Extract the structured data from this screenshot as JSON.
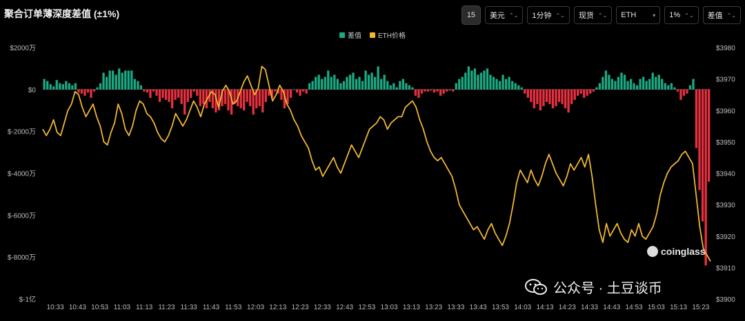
{
  "title": "聚合订单薄深度差值 (±1%)",
  "toolbar": {
    "icon": "15",
    "selects": [
      {
        "label": "美元",
        "chev": "⌃⌄"
      },
      {
        "label": "1分钟",
        "chev": "⌃⌄"
      },
      {
        "label": "现货",
        "chev": "⌃⌄"
      },
      {
        "label": "ETH",
        "chev": "▾"
      },
      {
        "label": "1%",
        "chev": "⌃⌄"
      },
      {
        "label": "差值",
        "chev": "⌃⌄"
      }
    ]
  },
  "legend": {
    "diff": {
      "label": "差值",
      "color": "#1aa983"
    },
    "price": {
      "label": "ETH价格",
      "color": "#f2b733"
    }
  },
  "watermark": "coinglass",
  "wechat_caption": "公众号 · 土豆谈币",
  "chart_data": {
    "type": "bar+line",
    "xticks": [
      "10:33",
      "10:43",
      "10:53",
      "11:03",
      "11:13",
      "11:23",
      "11:33",
      "11:43",
      "11:53",
      "12:03",
      "12:13",
      "12:23",
      "12:33",
      "12:43",
      "12:53",
      "13:03",
      "13:13",
      "13:23",
      "13:33",
      "13:43",
      "13:53",
      "14:03",
      "14:13",
      "14:23",
      "14:33",
      "14:43",
      "14:53",
      "15:03",
      "15:13",
      "15:23"
    ],
    "ylabels_left": [
      "$2000万",
      "$0",
      "$-2000万",
      "$-4000万",
      "$-6000万",
      "$-8000万",
      "$-1亿"
    ],
    "ylim_left": [
      -10000,
      2000
    ],
    "ylabels_right": [
      "$3980",
      "$3970",
      "$3960",
      "$3950",
      "$3940",
      "$3930",
      "$3920",
      "$3910",
      "$3900"
    ],
    "ylim_right": [
      3900,
      3980
    ],
    "series": [
      {
        "name": "差值",
        "unit": "万美元",
        "values": [
          500,
          400,
          250,
          150,
          450,
          300,
          250,
          400,
          300,
          200,
          300,
          -150,
          -200,
          -300,
          -150,
          -400,
          -100,
          100,
          300,
          800,
          600,
          900,
          900,
          700,
          1000,
          800,
          900,
          900,
          900,
          500,
          400,
          200,
          -100,
          -150,
          -400,
          -100,
          -300,
          -600,
          -400,
          -500,
          -600,
          -900,
          -500,
          -400,
          -700,
          -1200,
          -600,
          -400,
          -100,
          -300,
          -800,
          -700,
          -900,
          -600,
          -900,
          -1100,
          -1000,
          -800,
          -700,
          -1000,
          -1200,
          -700,
          -800,
          -900,
          -1000,
          -600,
          -800,
          -1200,
          -900,
          -800,
          -1100,
          -600,
          -300,
          -400,
          -100,
          -200,
          -500,
          -900,
          -700,
          -400,
          0,
          -150,
          -300,
          -100,
          -200,
          300,
          400,
          600,
          700,
          500,
          600,
          900,
          600,
          700,
          500,
          300,
          400,
          600,
          700,
          800,
          500,
          600,
          400,
          900,
          700,
          800,
          600,
          1100,
          500,
          700,
          400,
          200,
          300,
          100,
          400,
          500,
          300,
          200,
          100,
          -300,
          -400,
          -200,
          -100,
          -100,
          -50,
          -150,
          -100,
          -300,
          -200,
          -100,
          -50,
          -100,
          300,
          500,
          600,
          800,
          1100,
          900,
          1000,
          700,
          800,
          900,
          1000,
          700,
          600,
          500,
          400,
          700,
          500,
          600,
          400,
          300,
          200,
          100,
          -200,
          -400,
          -600,
          -900,
          -700,
          -1000,
          -800,
          -600,
          -700,
          -900,
          -800,
          -600,
          -700,
          -900,
          -1100,
          -700,
          -500,
          -300,
          -200,
          -400,
          -300,
          -200,
          -100,
          100,
          300,
          600,
          900,
          700,
          500,
          400,
          600,
          800,
          700,
          400,
          500,
          300,
          200,
          500,
          600,
          400,
          500,
          800,
          600,
          700,
          500,
          300,
          200,
          300,
          100,
          -100,
          -500,
          -300,
          -200,
          200,
          500,
          -2800,
          -4800,
          -6300,
          -8400,
          -4400
        ]
      },
      {
        "name": "ETH价格",
        "unit": "USD",
        "values": [
          3954,
          3952,
          3954,
          3957,
          3953,
          3952,
          3956,
          3960,
          3962,
          3966,
          3965,
          3961,
          3958,
          3960,
          3962,
          3958,
          3955,
          3950,
          3949,
          3953,
          3956,
          3962,
          3959,
          3954,
          3952,
          3955,
          3960,
          3963,
          3962,
          3959,
          3958,
          3956,
          3953,
          3951,
          3950,
          3952,
          3955,
          3959,
          3957,
          3955,
          3957,
          3960,
          3963,
          3961,
          3958,
          3962,
          3964,
          3966,
          3965,
          3961,
          3966,
          3968,
          3966,
          3962,
          3963,
          3966,
          3969,
          3971,
          3968,
          3965,
          3967,
          3974,
          3973,
          3968,
          3963,
          3965,
          3968,
          3966,
          3962,
          3960,
          3957,
          3955,
          3952,
          3950,
          3948,
          3944,
          3941,
          3942,
          3939,
          3941,
          3943,
          3945,
          3942,
          3940,
          3943,
          3946,
          3949,
          3947,
          3945,
          3948,
          3951,
          3954,
          3955,
          3956,
          3958,
          3957,
          3954,
          3956,
          3957,
          3958,
          3958,
          3961,
          3962,
          3963,
          3961,
          3957,
          3954,
          3950,
          3947,
          3945,
          3944,
          3945,
          3943,
          3941,
          3939,
          3935,
          3930,
          3928,
          3926,
          3924,
          3922,
          3923,
          3921,
          3919,
          3922,
          3924,
          3921,
          3919,
          3917,
          3920,
          3924,
          3930,
          3937,
          3941,
          3939,
          3937,
          3941,
          3938,
          3936,
          3939,
          3943,
          3946,
          3943,
          3940,
          3938,
          3936,
          3939,
          3943,
          3941,
          3943,
          3945,
          3942,
          3946,
          3939,
          3930,
          3922,
          3918,
          3924,
          3920,
          3922,
          3924,
          3921,
          3919,
          3918,
          3922,
          3920,
          3924,
          3920,
          3919,
          3921,
          3923,
          3927,
          3933,
          3937,
          3940,
          3942,
          3943,
          3944,
          3946,
          3947,
          3945,
          3943,
          3933,
          3923,
          3916,
          3914,
          3912
        ]
      }
    ],
    "grid": false,
    "legend_position": "top-center"
  }
}
